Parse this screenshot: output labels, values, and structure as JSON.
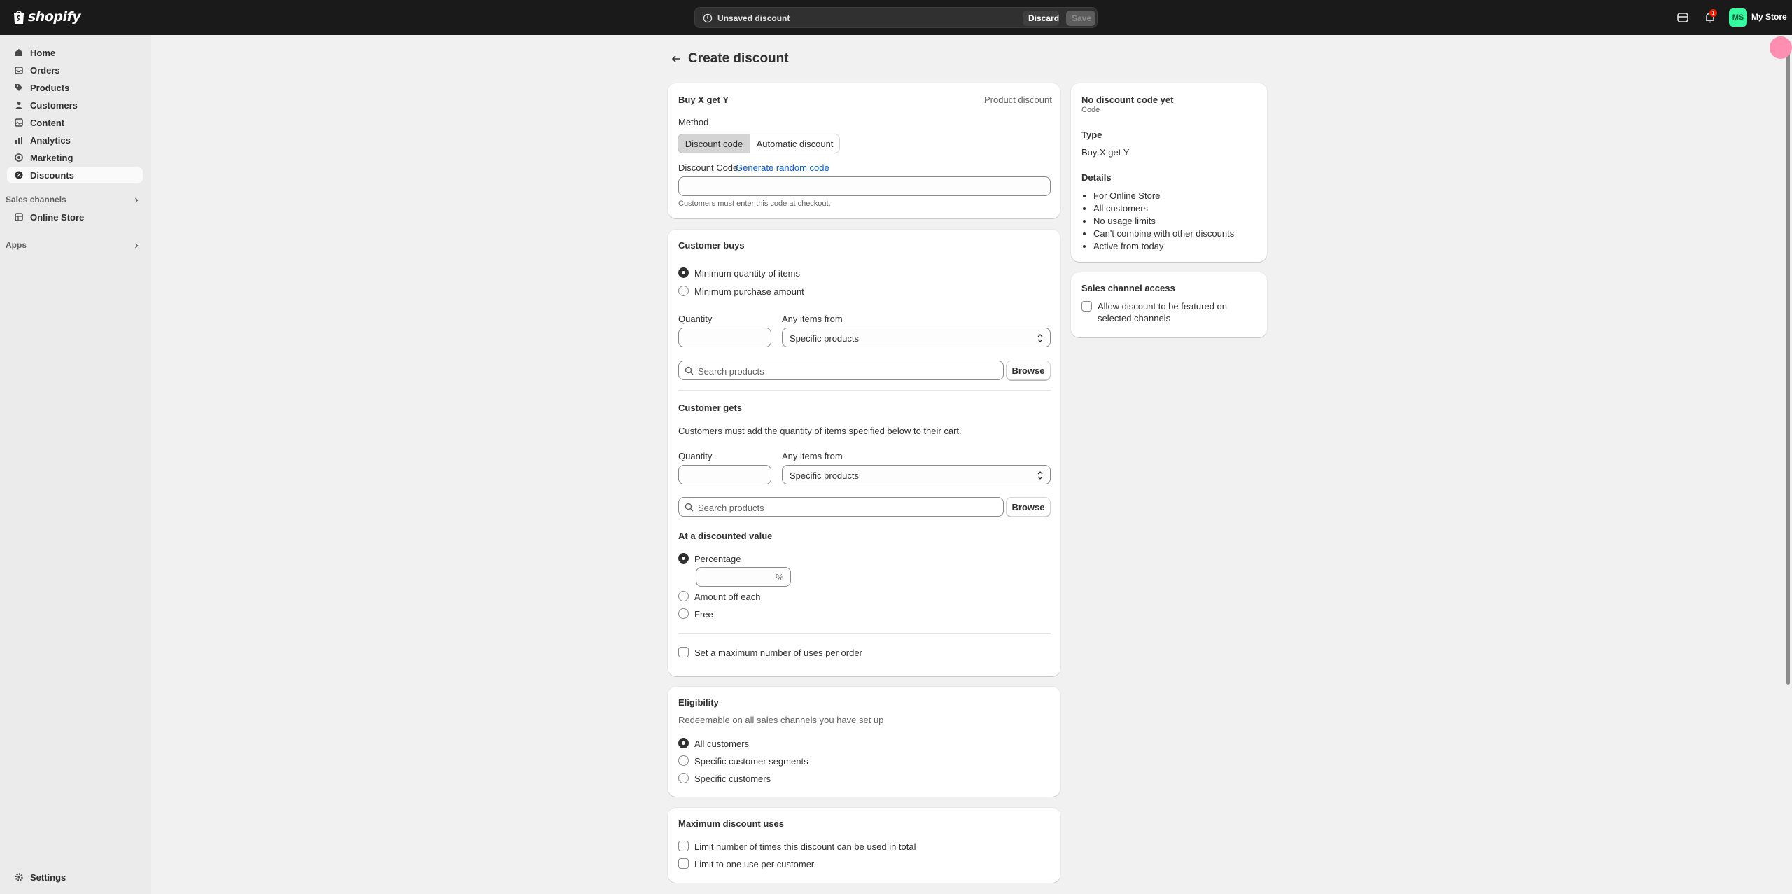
{
  "topbar": {
    "brand": "shopify",
    "savebar_label": "Unsaved discount",
    "discard_label": "Discard",
    "save_label": "Save",
    "notification_count": "1",
    "avatar_initials": "MS",
    "store_name": "My Store",
    "colors": {
      "bar": "#1a1a1a",
      "avatar": "#36fba1"
    }
  },
  "sidebar": {
    "items": [
      {
        "label": "Home",
        "icon": "home-icon"
      },
      {
        "label": "Orders",
        "icon": "orders-icon"
      },
      {
        "label": "Products",
        "icon": "tag-icon"
      },
      {
        "label": "Customers",
        "icon": "person-icon"
      },
      {
        "label": "Content",
        "icon": "content-icon"
      },
      {
        "label": "Analytics",
        "icon": "bar-chart-icon"
      },
      {
        "label": "Marketing",
        "icon": "target-icon"
      },
      {
        "label": "Discounts",
        "icon": "discount-icon",
        "active": true
      }
    ],
    "sales_channels_label": "Sales channels",
    "online_store_label": "Online Store",
    "apps_label": "Apps",
    "settings_label": "Settings"
  },
  "page": {
    "title": "Create discount"
  },
  "method_card": {
    "title": "Buy X get Y",
    "kind": "Product discount",
    "method_label": "Method",
    "method_options": [
      "Discount code",
      "Automatic discount"
    ],
    "selected_method": "Discount code",
    "code_label": "Discount Code",
    "generate_link": "Generate random code",
    "code_value": "",
    "help": "Customers must enter this code at checkout."
  },
  "customer_buys": {
    "title": "Customer buys",
    "options": [
      "Minimum quantity of items",
      "Minimum purchase amount"
    ],
    "selected": "Minimum quantity of items",
    "quantity_label": "Quantity",
    "items_from_label": "Any items from",
    "items_from_value": "Specific products",
    "search_placeholder": "Search products",
    "browse_label": "Browse"
  },
  "customer_gets": {
    "title": "Customer gets",
    "help": "Customers must add the quantity of items specified below to their cart.",
    "quantity_label": "Quantity",
    "items_from_label": "Any items from",
    "items_from_value": "Specific products",
    "search_placeholder": "Search products",
    "browse_label": "Browse",
    "discounted_value_title": "At a discounted value",
    "value_options": [
      "Percentage",
      "Amount off each",
      "Free"
    ],
    "selected_value": "Percentage",
    "percent_suffix": "%",
    "max_uses_label": "Set a maximum number of uses per order"
  },
  "eligibility": {
    "title": "Eligibility",
    "help": "Redeemable on all sales channels you have set up",
    "options": [
      "All customers",
      "Specific customer segments",
      "Specific customers"
    ],
    "selected": "All customers"
  },
  "max_uses": {
    "title": "Maximum discount uses",
    "options": [
      "Limit number of times this discount can be used in total",
      "Limit to one use per customer"
    ]
  },
  "summary": {
    "code_title": "No discount code yet",
    "code_sub": "Code",
    "type_label": "Type",
    "type_value": "Buy X get Y",
    "details_label": "Details",
    "details": [
      "For Online Store",
      "All customers",
      "No usage limits",
      "Can't combine with other discounts",
      "Active from today"
    ]
  },
  "sales_channel": {
    "title": "Sales channel access",
    "option_line1": "Allow discount to be featured on",
    "option_line2": "selected channels"
  }
}
